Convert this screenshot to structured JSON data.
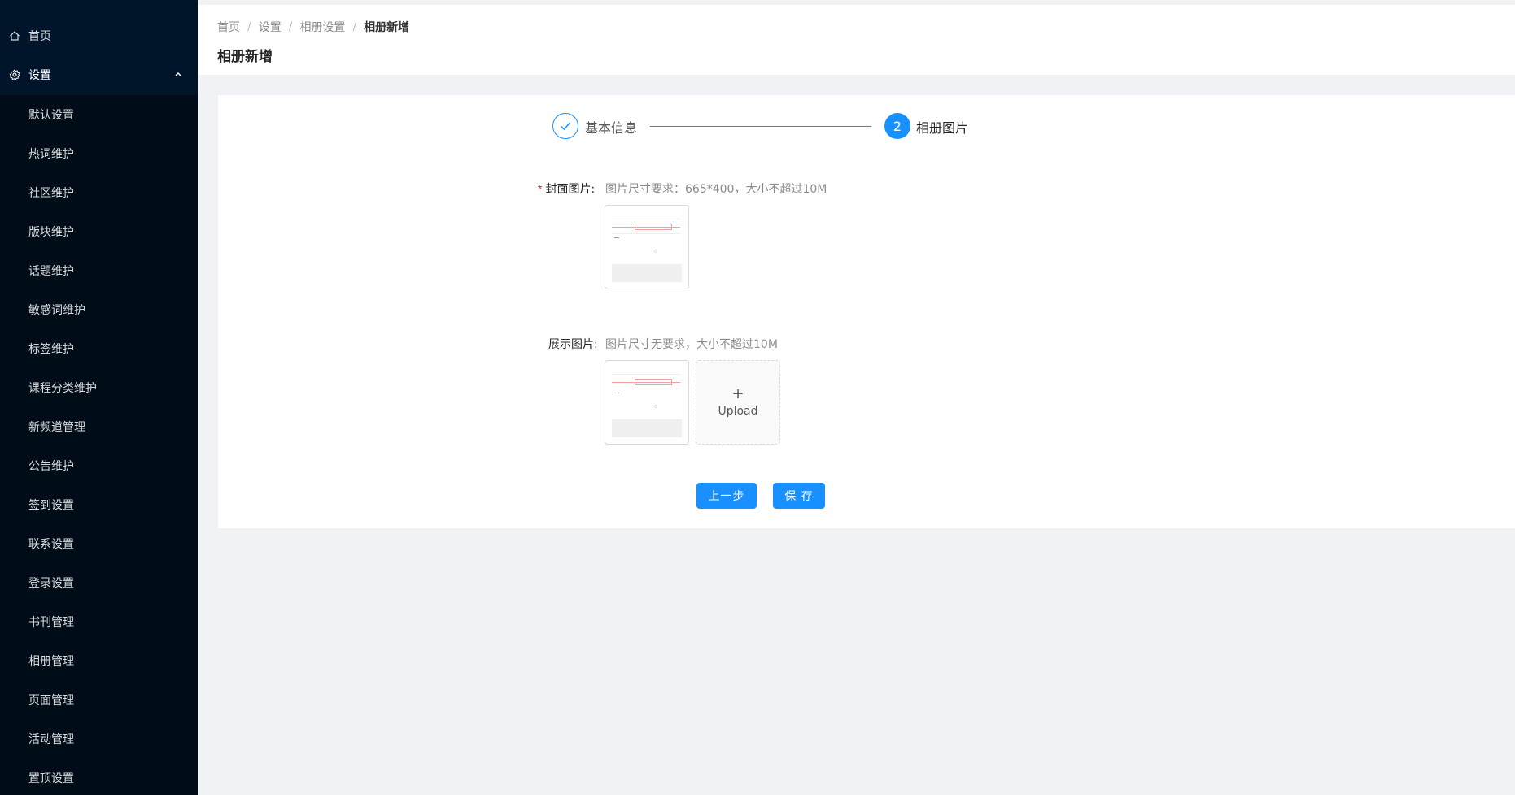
{
  "sidebar": {
    "home": {
      "label": "首页",
      "icon": "home-icon"
    },
    "settings": {
      "label": "设置",
      "icon": "gear-icon",
      "expanded": true
    },
    "items": [
      {
        "label": "默认设置"
      },
      {
        "label": "热词维护"
      },
      {
        "label": "社区维护"
      },
      {
        "label": "版块维护"
      },
      {
        "label": "话题维护"
      },
      {
        "label": "敏感词维护"
      },
      {
        "label": "标签维护"
      },
      {
        "label": "课程分类维护"
      },
      {
        "label": "新频道管理"
      },
      {
        "label": "公告维护"
      },
      {
        "label": "签到设置"
      },
      {
        "label": "联系设置"
      },
      {
        "label": "登录设置"
      },
      {
        "label": "书刊管理"
      },
      {
        "label": "相册管理"
      },
      {
        "label": "页面管理"
      },
      {
        "label": "活动管理"
      },
      {
        "label": "置顶设置"
      }
    ]
  },
  "breadcrumb": {
    "items": [
      "首页",
      "设置",
      "相册设置"
    ],
    "current": "相册新增",
    "separator": "/"
  },
  "page_title": "相册新增",
  "steps": [
    {
      "title": "基本信息",
      "status": "finish"
    },
    {
      "number": "2",
      "title": "相册图片",
      "status": "process"
    }
  ],
  "form": {
    "cover": {
      "required_mark": "*",
      "label": "封面图片:",
      "hint": "图片尺寸要求：665*400，大小不超过10M"
    },
    "display": {
      "label": "展示图片:",
      "hint": "图片尺寸无要求，大小不超过10M",
      "upload_plus": "+",
      "upload_text": "Upload"
    }
  },
  "buttons": {
    "prev": "上一步",
    "save": "保 存"
  },
  "colors": {
    "sidebar_bg": "#001529",
    "submenu_bg": "#000c17",
    "primary": "#1890ff",
    "required": "#f5222d"
  }
}
